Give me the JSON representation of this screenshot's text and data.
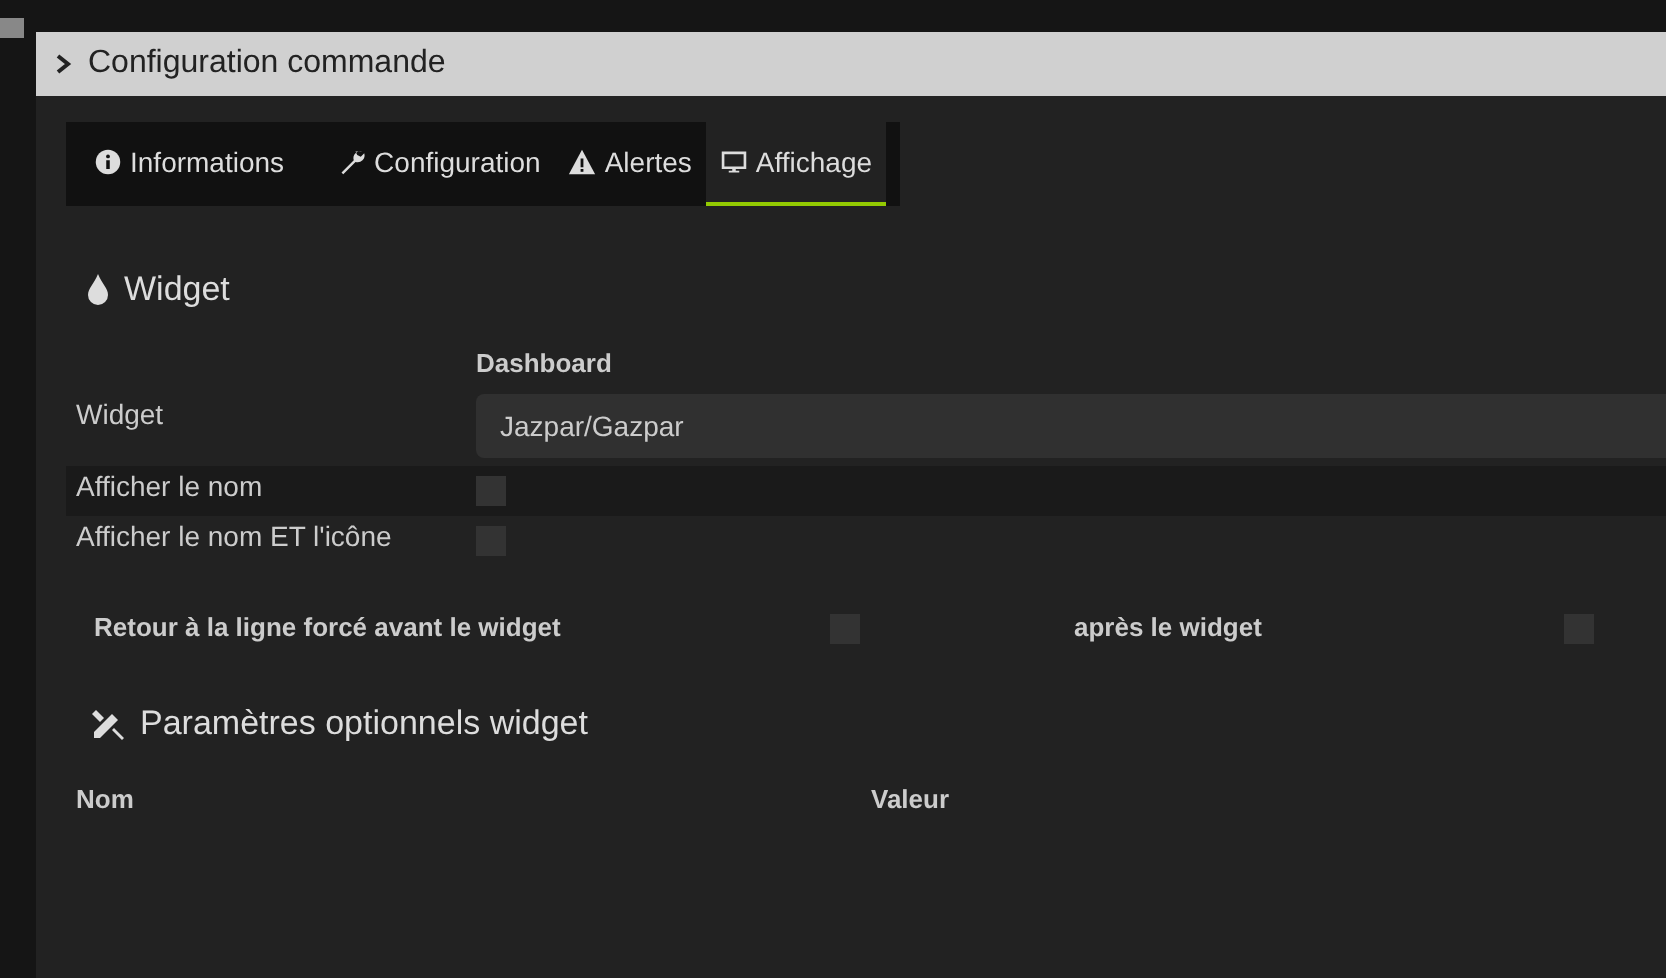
{
  "window": {
    "title": "Configuration commande"
  },
  "tabs": [
    {
      "label": "Informations",
      "selected": false
    },
    {
      "label": "Configuration",
      "selected": false
    },
    {
      "label": "Alertes",
      "selected": false
    },
    {
      "label": "Affichage",
      "selected": true
    }
  ],
  "widget_section": {
    "title": "Widget",
    "column_header": "Dashboard",
    "rows": [
      {
        "kind": "select",
        "label": "Widget",
        "value": "Jazpar/Gazpar"
      },
      {
        "kind": "checkbox",
        "label": "Afficher le nom",
        "checked": false
      },
      {
        "kind": "checkbox",
        "label": "Afficher le nom ET l'icône",
        "checked": false
      }
    ]
  },
  "line_breaks": [
    {
      "label": "Retour à la ligne forcé avant le widget",
      "checked": false
    },
    {
      "label": "après le widget",
      "checked": false
    }
  ],
  "optional_section": {
    "title": "Paramètres optionnels widget",
    "columns": [
      "Nom",
      "Valeur"
    ]
  }
}
